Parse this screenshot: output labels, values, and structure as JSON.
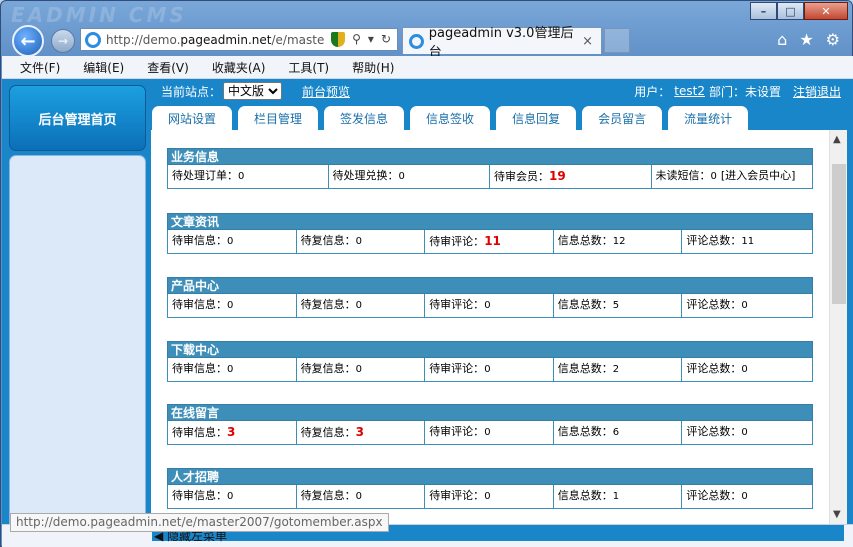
{
  "browser": {
    "watermark": "EADMIN CMS",
    "url_prefix": "http://demo.",
    "url_domain": "pageadmin.net",
    "url_suffix": "/e/master...",
    "tab_title": "pageadmin v3.0管理后台",
    "tab_close": "×",
    "window_buttons": [
      "–",
      "□",
      "✕"
    ],
    "nav_icons": [
      "home-icon",
      "star-icon",
      "gear-icon"
    ]
  },
  "menu": [
    "文件(F)",
    "编辑(E)",
    "查看(V)",
    "收藏夹(A)",
    "工具(T)",
    "帮助(H)"
  ],
  "sidebar": {
    "home_label": "后台管理首页"
  },
  "topbar": {
    "site_label": "当前站点：",
    "site_value": "中文版",
    "preview_link": "前台预览",
    "user_label": "用户：",
    "user_name": "test2",
    "dept_label": "部门：未设置",
    "logout": "注销退出"
  },
  "tabs": [
    "网站设置",
    "栏目管理",
    "签发信息",
    "信息签收",
    "信息回复",
    "会员留言",
    "流量统计"
  ],
  "sections": [
    {
      "title": "业务信息",
      "cells": [
        {
          "label": "待处理订单：",
          "value": "0",
          "red": false
        },
        {
          "label": "待处理兑换：",
          "value": "0",
          "red": false
        },
        {
          "label": "待审会员：",
          "value": "19",
          "red": true
        },
        {
          "label": "未读短信：",
          "value": "0",
          "extra": "[进入会员中心]",
          "red": false
        }
      ]
    },
    {
      "title": "文章资讯",
      "cells": [
        {
          "label": "待审信息：",
          "value": "0",
          "red": false
        },
        {
          "label": "待复信息：",
          "value": "0",
          "red": false
        },
        {
          "label": "待审评论：",
          "value": "11",
          "red": true
        },
        {
          "label": "信息总数：",
          "value": "12",
          "red": false
        },
        {
          "label": "评论总数：",
          "value": "11",
          "red": false
        }
      ]
    },
    {
      "title": "产品中心",
      "cells": [
        {
          "label": "待审信息：",
          "value": "0",
          "red": false
        },
        {
          "label": "待复信息：",
          "value": "0",
          "red": false
        },
        {
          "label": "待审评论：",
          "value": "0",
          "red": false
        },
        {
          "label": "信息总数：",
          "value": "5",
          "red": false
        },
        {
          "label": "评论总数：",
          "value": "0",
          "red": false
        }
      ]
    },
    {
      "title": "下载中心",
      "cells": [
        {
          "label": "待审信息：",
          "value": "0",
          "red": false
        },
        {
          "label": "待复信息：",
          "value": "0",
          "red": false
        },
        {
          "label": "待审评论：",
          "value": "0",
          "red": false
        },
        {
          "label": "信息总数：",
          "value": "2",
          "red": false
        },
        {
          "label": "评论总数：",
          "value": "0",
          "red": false
        }
      ]
    },
    {
      "title": "在线留言",
      "cells": [
        {
          "label": "待审信息：",
          "value": "3",
          "red": true
        },
        {
          "label": "待复信息：",
          "value": "3",
          "red": true
        },
        {
          "label": "待审评论：",
          "value": "0",
          "red": false
        },
        {
          "label": "信息总数：",
          "value": "6",
          "red": false
        },
        {
          "label": "评论总数：",
          "value": "0",
          "red": false
        }
      ]
    },
    {
      "title": "人才招聘",
      "cells": [
        {
          "label": "待审信息：",
          "value": "0",
          "red": false
        },
        {
          "label": "待复信息：",
          "value": "0",
          "red": false
        },
        {
          "label": "待审评论：",
          "value": "0",
          "red": false
        },
        {
          "label": "信息总数：",
          "value": "1",
          "red": false
        },
        {
          "label": "评论总数：",
          "value": "0",
          "red": false
        }
      ]
    }
  ],
  "status": {
    "hide_menu": "◀ 隐藏左菜单",
    "tooltip_url": "http://demo.pageadmin.net/e/master2007/gotomember.aspx"
  }
}
